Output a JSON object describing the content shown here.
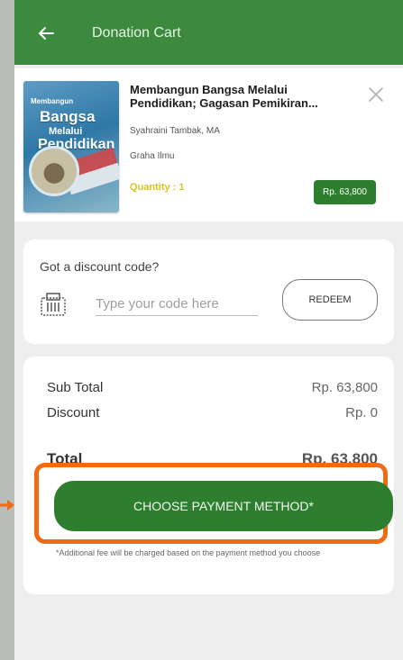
{
  "header": {
    "title": "Donation Cart",
    "back_icon": "arrow-left-icon"
  },
  "product": {
    "title": "Membangun Bangsa Melalui Pendidikan; Gagasan Pemikiran...",
    "author": "Syahraini Tambak, MA",
    "publisher": "Graha Ilmu",
    "quantity": "Quantity : 1",
    "price": "Rp. 63,800",
    "cover_text": {
      "line1": "Membangun",
      "line2": "Bangsa",
      "line3": "Melalui",
      "line4": "Pendidikan"
    },
    "close_icon": "close-icon"
  },
  "discount": {
    "label": "Got a discount code?",
    "placeholder": "Type your code here",
    "value": "",
    "redeem_label": "REDEEM",
    "coupon_icon": "coupon-icon"
  },
  "totals": {
    "subtotal_label": "Sub Total",
    "subtotal_value": "Rp. 63,800",
    "discount_label": "Discount",
    "discount_value": "Rp. 0",
    "total_label": "Total",
    "total_value": "Rp. 63,800"
  },
  "payment": {
    "button_label": "CHOOSE PAYMENT METHOD*",
    "note": "*Additional fee will be charged based on the payment method you choose"
  },
  "colors": {
    "brand_green": "#3b8a3d",
    "button_green": "#2d7f2f",
    "quantity_yellow": "#d9c323",
    "highlight_orange": "#f26a13"
  }
}
